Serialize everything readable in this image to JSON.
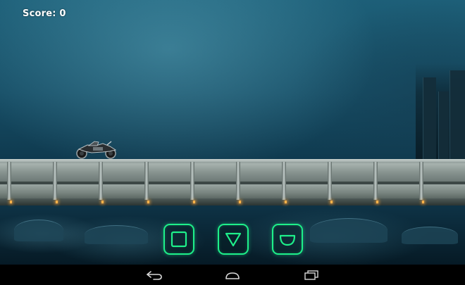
{
  "hud": {
    "score_label": "Score: 0"
  },
  "controls": {
    "accent_color": "#1ef08a",
    "buttons": [
      {
        "id": "square",
        "icon": "square-icon"
      },
      {
        "id": "down",
        "icon": "down-triangle-icon"
      },
      {
        "id": "bowl",
        "icon": "bowl-icon"
      }
    ]
  },
  "navigation_bar": {
    "items": [
      {
        "id": "back",
        "icon": "back-arrow-icon"
      },
      {
        "id": "home",
        "icon": "home-icon"
      },
      {
        "id": "recent",
        "icon": "recent-apps-icon"
      }
    ]
  },
  "colors": {
    "sky_top": "#1d5f78",
    "sky_bottom": "#0b2b3c",
    "bridge_metal": "#a9b4b0",
    "bridge_lights": "#ffb24a"
  }
}
